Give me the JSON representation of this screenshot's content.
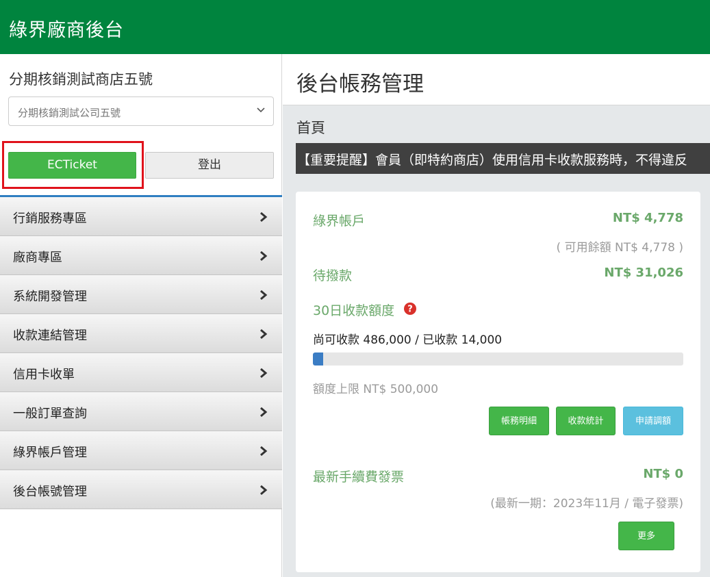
{
  "header": {
    "title": "綠界廠商後台"
  },
  "sidebar": {
    "store_name": "分期核銷測試商店五號",
    "company_select": {
      "value": "分期核銷測試公司五號"
    },
    "ecticket_label": "ECTicket",
    "logout_label": "登出",
    "menu": [
      {
        "label": "行銷服務專區"
      },
      {
        "label": "廠商專區"
      },
      {
        "label": "系統開發管理"
      },
      {
        "label": "收款連結管理"
      },
      {
        "label": "信用卡收單"
      },
      {
        "label": "一般訂單查詢"
      },
      {
        "label": "綠界帳戶管理"
      },
      {
        "label": "後台帳號管理"
      }
    ]
  },
  "main": {
    "title": "後台帳務管理",
    "breadcrumb": "首頁",
    "notice": "【重要提醒】會員（即特約商店）使用信用卡收款服務時，不得違反",
    "account": {
      "label": "綠界帳戶",
      "amount": "NT$ 4,778",
      "available": "( 可用餘額 NT$ 4,778 )"
    },
    "pending": {
      "label": "待撥款",
      "amount": "NT$ 31,026"
    },
    "quota": {
      "label": "30日收款額度",
      "status": "尚可收款 486,000 / 已收款 14,000",
      "progress_fraction": 0.028,
      "limit": "額度上限 NT$ 500,000"
    },
    "buttons": {
      "details": "帳務明細",
      "stats": "收款統計",
      "adjust": "申請調額"
    },
    "invoice": {
      "label": "最新手續費發票",
      "amount": "NT$ 0",
      "period": "(最新一期：2023年11月 / 電子發票)",
      "more": "更多"
    },
    "colors": {
      "brand": "#00843e",
      "accent_green": "#44b649",
      "info_blue": "#5bc0de",
      "highlight_red": "#e0121b"
    }
  }
}
